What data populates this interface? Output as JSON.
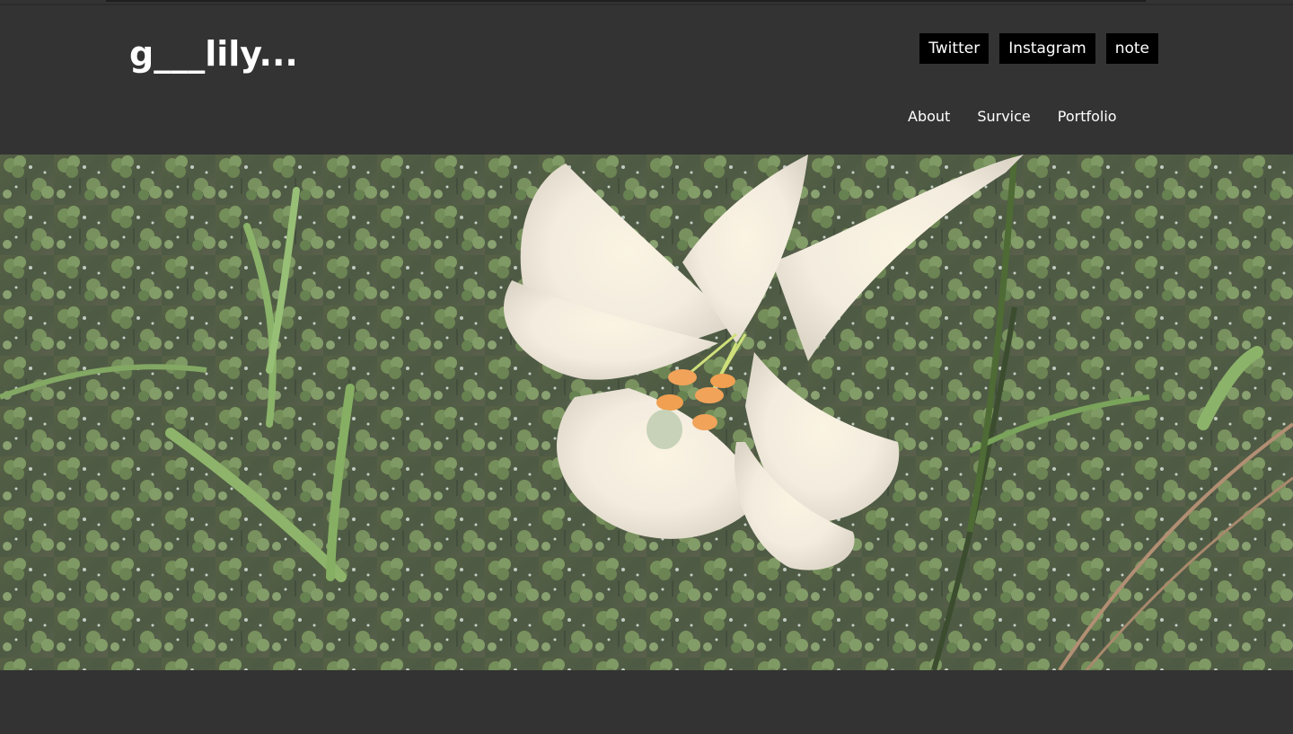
{
  "site": {
    "title": "g___lily..."
  },
  "social_links": [
    {
      "label": "Twitter"
    },
    {
      "label": "Instagram"
    },
    {
      "label": "note"
    }
  ],
  "nav": {
    "items": [
      {
        "label": "About"
      },
      {
        "label": "Survice"
      },
      {
        "label": "Portfolio"
      }
    ]
  },
  "hero": {
    "subject": "white lily flower among clover and grass",
    "image_icon": "lily-photo"
  },
  "colors": {
    "background": "#333333",
    "button_bg": "#000000",
    "text": "#ffffff"
  }
}
